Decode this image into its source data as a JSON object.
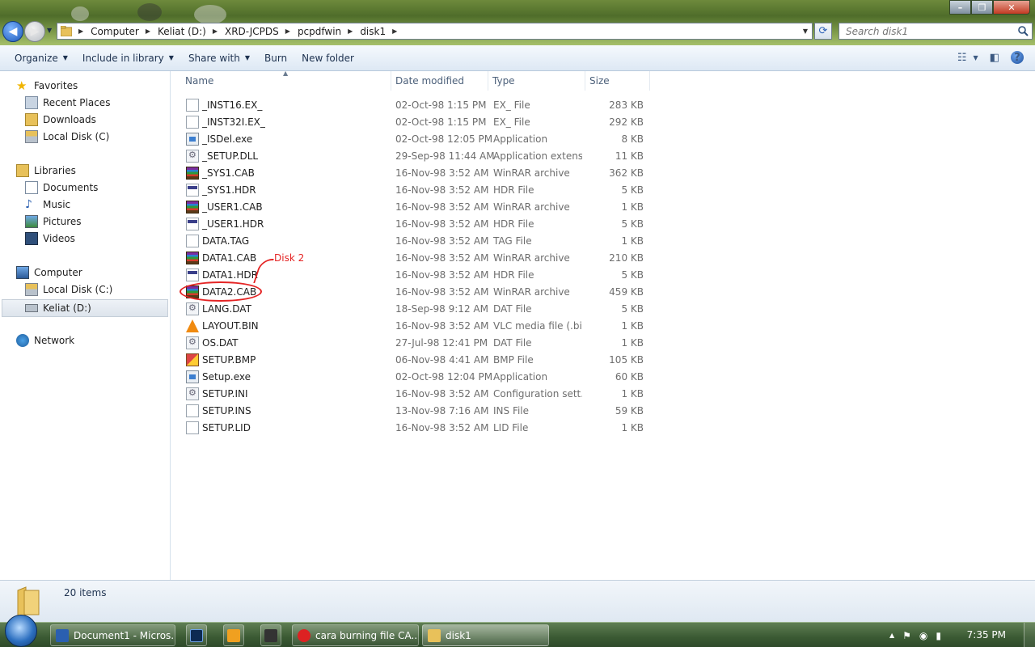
{
  "window": {
    "back_icon": "back-arrow-icon",
    "forward_icon": "forward-arrow-icon",
    "address": {
      "segments": [
        "Computer",
        "Keliat (D:)",
        "XRD-JCPDS",
        "pcpdfwin",
        "disk1"
      ]
    },
    "search": {
      "placeholder": "Search disk1"
    }
  },
  "toolbar": {
    "organize": "Organize",
    "include_in_library": "Include in library",
    "share_with": "Share with",
    "burn": "Burn",
    "new_folder": "New folder"
  },
  "navpane": {
    "favorites": "Favorites",
    "recent_places": "Recent Places",
    "downloads": "Downloads",
    "local_disk_c_fav": "Local Disk (C)",
    "libraries": "Libraries",
    "documents": "Documents",
    "music": "Music",
    "pictures": "Pictures",
    "videos": "Videos",
    "computer": "Computer",
    "local_disk_c": "Local Disk (C:)",
    "keliat_d": "Keliat (D:)",
    "network": "Network"
  },
  "columns": {
    "name": "Name",
    "date_modified": "Date modified",
    "type": "Type",
    "size": "Size"
  },
  "files": [
    {
      "name": "_INST16.EX_",
      "date": "02-Oct-98 1:15 PM",
      "type": "EX_ File",
      "size": "283 KB",
      "icon": "doc"
    },
    {
      "name": "_INST32I.EX_",
      "date": "02-Oct-98 1:15 PM",
      "type": "EX_ File",
      "size": "292 KB",
      "icon": "doc"
    },
    {
      "name": "_ISDel.exe",
      "date": "02-Oct-98 12:05 PM",
      "type": "Application",
      "size": "8 KB",
      "icon": "exe"
    },
    {
      "name": "_SETUP.DLL",
      "date": "29-Sep-98 11:44 AM",
      "type": "Application extens...",
      "size": "11 KB",
      "icon": "gear"
    },
    {
      "name": "_SYS1.CAB",
      "date": "16-Nov-98 3:52 AM",
      "type": "WinRAR archive",
      "size": "362 KB",
      "icon": "cab"
    },
    {
      "name": "_SYS1.HDR",
      "date": "16-Nov-98 3:52 AM",
      "type": "HDR File",
      "size": "5 KB",
      "icon": "hdr"
    },
    {
      "name": "_USER1.CAB",
      "date": "16-Nov-98 3:52 AM",
      "type": "WinRAR archive",
      "size": "1 KB",
      "icon": "cab"
    },
    {
      "name": "_USER1.HDR",
      "date": "16-Nov-98 3:52 AM",
      "type": "HDR File",
      "size": "5 KB",
      "icon": "hdr"
    },
    {
      "name": "DATA.TAG",
      "date": "16-Nov-98 3:52 AM",
      "type": "TAG File",
      "size": "1 KB",
      "icon": "doc"
    },
    {
      "name": "DATA1.CAB",
      "date": "16-Nov-98 3:52 AM",
      "type": "WinRAR archive",
      "size": "210 KB",
      "icon": "cab"
    },
    {
      "name": "DATA1.HDR",
      "date": "16-Nov-98 3:52 AM",
      "type": "HDR File",
      "size": "5 KB",
      "icon": "hdr"
    },
    {
      "name": "DATA2.CAB",
      "date": "16-Nov-98 3:52 AM",
      "type": "WinRAR archive",
      "size": "459 KB",
      "icon": "cab"
    },
    {
      "name": "LANG.DAT",
      "date": "18-Sep-98 9:12 AM",
      "type": "DAT File",
      "size": "5 KB",
      "icon": "gear"
    },
    {
      "name": "LAYOUT.BIN",
      "date": "16-Nov-98 3:52 AM",
      "type": "VLC media file (.bi...",
      "size": "1 KB",
      "icon": "vlc"
    },
    {
      "name": "OS.DAT",
      "date": "27-Jul-98 12:41 PM",
      "type": "DAT File",
      "size": "1 KB",
      "icon": "gear"
    },
    {
      "name": "SETUP.BMP",
      "date": "06-Nov-98 4:41 AM",
      "type": "BMP File",
      "size": "105 KB",
      "icon": "bmp"
    },
    {
      "name": "Setup.exe",
      "date": "02-Oct-98 12:04 PM",
      "type": "Application",
      "size": "60 KB",
      "icon": "exe"
    },
    {
      "name": "SETUP.INI",
      "date": "16-Nov-98 3:52 AM",
      "type": "Configuration sett...",
      "size": "1 KB",
      "icon": "gear"
    },
    {
      "name": "SETUP.INS",
      "date": "13-Nov-98 7:16 AM",
      "type": "INS File",
      "size": "59 KB",
      "icon": "doc"
    },
    {
      "name": "SETUP.LID",
      "date": "16-Nov-98 3:52 AM",
      "type": "LID File",
      "size": "1 KB",
      "icon": "doc"
    }
  ],
  "annotation": {
    "text": "Disk 2",
    "color": "#e42424"
  },
  "details": {
    "count": "20 items"
  },
  "taskbar": {
    "buttons": [
      "Document1 - Micros...",
      "cara burning file CA...",
      "disk1"
    ],
    "clock": "7:35 PM"
  }
}
